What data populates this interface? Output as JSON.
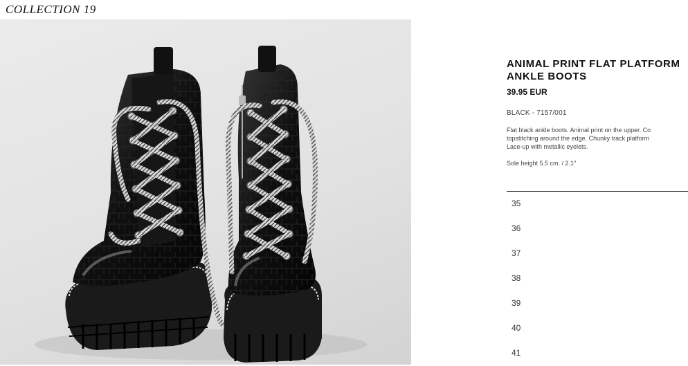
{
  "header": {
    "collection_label": "COLLECTION 19"
  },
  "product": {
    "title": "ANIMAL PRINT FLAT PLATFORM\nANKLE BOOTS",
    "price": "39.95 EUR",
    "color_ref": "BLACK - 7157/001",
    "description": "Flat black ankle boots. Animal print on the upper. Co\ntopstitching around the edge. Chunky track platform\nLace-up with metallic eyelets.",
    "sole_height": "Sole height 5.5 cm. / 2.1″",
    "image_alt": "Black croc-effect lace-up ankle boots with chunky track soles"
  },
  "sizes": [
    "35",
    "36",
    "37",
    "38",
    "39",
    "40",
    "41"
  ]
}
